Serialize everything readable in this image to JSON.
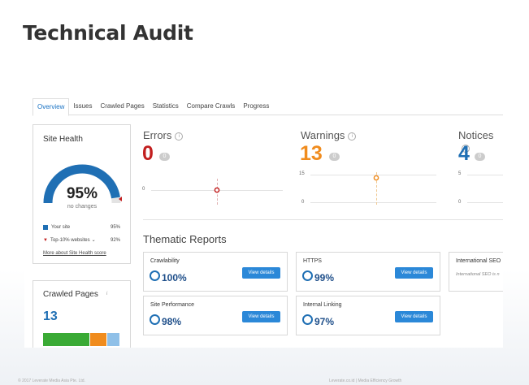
{
  "slide": {
    "title": "Technical Audit"
  },
  "tabs": [
    "Overview",
    "Issues",
    "Crawled Pages",
    "Statistics",
    "Compare Crawls",
    "Progress"
  ],
  "site_health": {
    "title": "Site Health",
    "percent": "95%",
    "percent_value": 95,
    "change": "no changes",
    "legend": [
      {
        "label": "Your site",
        "value": "95%"
      },
      {
        "label": "Top-10% websites",
        "value": "92%"
      }
    ],
    "link": "More about Site Health score"
  },
  "metrics": {
    "errors": {
      "label": "Errors",
      "value": "0",
      "badge": "0",
      "axis": [
        "0"
      ],
      "color": "#c21f1f"
    },
    "warnings": {
      "label": "Warnings",
      "value": "13",
      "badge": "0",
      "axis": [
        "15",
        "0"
      ],
      "color": "#f08c1e"
    },
    "notices": {
      "label": "Notices",
      "value": "4",
      "badge": "0",
      "axis": [
        "5",
        "0"
      ],
      "color": "#1f6fb4"
    }
  },
  "crawled_pages": {
    "title": "Crawled Pages",
    "count": "13"
  },
  "thematic": {
    "title": "Thematic Reports",
    "button_label": "View details",
    "reports": [
      {
        "name": "Crawlability",
        "value": "100%"
      },
      {
        "name": "HTTPS",
        "value": "99%"
      },
      {
        "name": "International SEO",
        "note": "International SEO is n"
      },
      {
        "name": "Site Performance",
        "value": "98%"
      },
      {
        "name": "Internal Linking",
        "value": "97%"
      }
    ]
  },
  "colors": {
    "accent": "#2b88d8",
    "gauge": "#1f6fb4",
    "bar_green": "#3aaa35",
    "bar_orange": "#f08c1e",
    "bar_blue": "#8fc0e8"
  },
  "footer": {
    "left": "© 2017 Leverate Media Asia Pte. Ltd.",
    "right": "Leverate.co.id | Media Efficiency Growth"
  }
}
